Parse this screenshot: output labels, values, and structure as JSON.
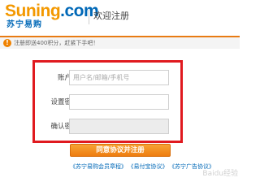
{
  "header": {
    "logo_main_prefix": "Suning",
    "logo_main_suffix": ".com",
    "logo_sub": "苏宁易购",
    "page_title": "欢迎注册"
  },
  "notice": {
    "icon": "!",
    "text": "注册即送400积分，赶紧下手吧！"
  },
  "form": {
    "account_label": "账户名：",
    "account_placeholder": "用户名/邮箱/手机号",
    "password_label": "设置密码：",
    "password_value": "",
    "confirm_label": "确认密码：",
    "confirm_value": ""
  },
  "actions": {
    "submit_label": "同意协议并注册"
  },
  "links": [
    "《苏宁易购会员章程》",
    "《易付宝协议》",
    "《苏宁广告协议》"
  ],
  "watermark": "Baidu经验",
  "colors": {
    "brand_orange": "#f39800",
    "brand_blue": "#0068b7",
    "highlight_red": "#e01a1f"
  }
}
